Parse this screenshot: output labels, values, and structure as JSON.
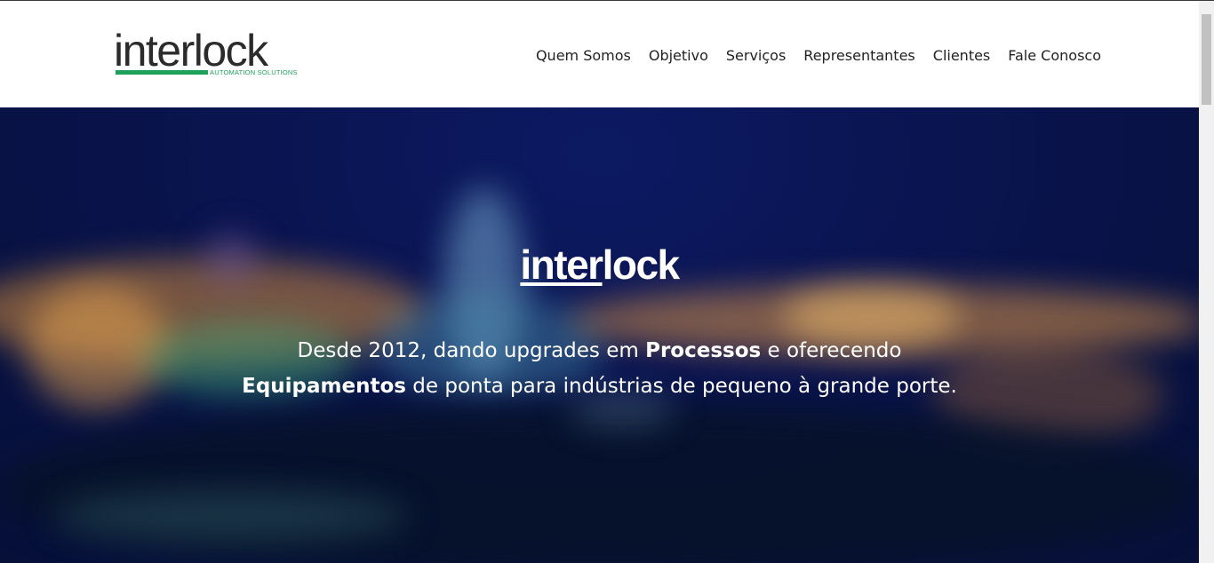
{
  "header": {
    "logo": {
      "word_part1": "inter",
      "word_part2": "lock",
      "tagline": "AUTOMATION SOLUTIONS",
      "accent_color": "#1ea25a"
    },
    "nav": [
      {
        "label": "Quem Somos"
      },
      {
        "label": "Objetivo"
      },
      {
        "label": "Serviços"
      },
      {
        "label": "Representantes"
      },
      {
        "label": "Clientes"
      },
      {
        "label": "Fale Conosco"
      }
    ]
  },
  "hero": {
    "title_part1": "inter",
    "title_part2": "lock",
    "subtitle": {
      "line1_a": "Desde 2012, dando upgrades em ",
      "line1_bold": "Processos",
      "line1_b": " e oferecendo",
      "line2_bold": "Equipamentos",
      "line2_a": " de ponta para indústrias de pequeno à grande porte."
    },
    "background_color": "#0a1450"
  }
}
